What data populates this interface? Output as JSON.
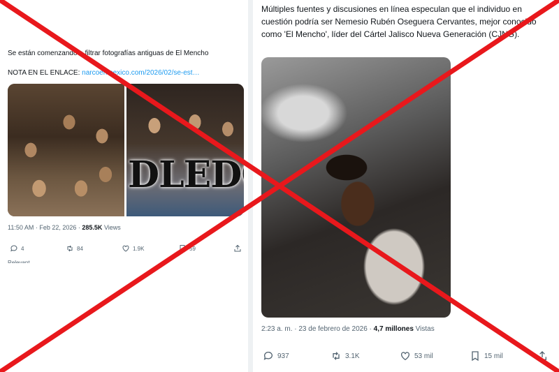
{
  "left_tweet": {
    "text_line1": "Se están comenzando a filtrar fotografías antiguas de El Mencho",
    "note_label": "NOTA EN EL ENLACE: ",
    "note_link": "narcoenmexico.com/2026/02/se-est…",
    "watermark": "DLEDO",
    "time": "11:50 AM · Feb 22, 2026 · ",
    "views_count": "285.5K",
    "views_label": " Views",
    "replies": "4",
    "reposts": "84",
    "likes": "1.9K",
    "bookmarks": "59",
    "cutoff_text": "Relevant"
  },
  "right_tweet": {
    "body": "Múltiples fuentes y discusiones en línea especulan que el individuo en cuestión podría ser Nemesio Rubén Oseguera Cervantes, mejor conocido como 'El Mencho', líder del Cártel Jalisco Nueva Generación (CJNG).",
    "time": "2:23 a. m. · 23 de febrero de 2026 · ",
    "views_count": "4,7 millones",
    "views_label": " Vistas",
    "replies": "937",
    "reposts": "3.1K",
    "likes": "53 mil",
    "bookmarks": "15 mil"
  },
  "colors": {
    "overlay_x": "#e8181c",
    "link": "#1d9bf0",
    "muted": "#536471"
  },
  "icons": [
    "reply-icon",
    "repost-icon",
    "like-icon",
    "bookmark-icon",
    "share-icon"
  ]
}
